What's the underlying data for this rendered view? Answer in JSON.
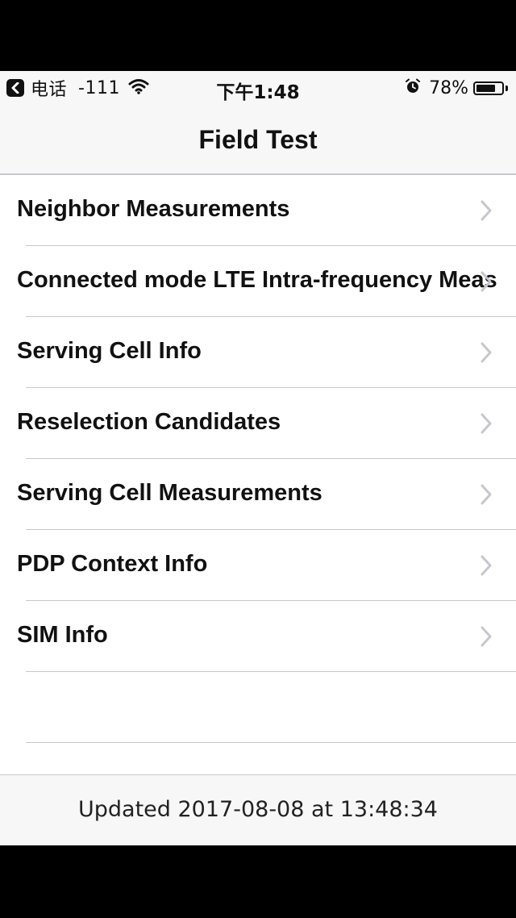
{
  "status_bar": {
    "back_app": "电话",
    "signal": "-111",
    "time": "下午1:48",
    "battery_percent": "78%",
    "battery_level": 0.78
  },
  "nav": {
    "title": "Field Test"
  },
  "menu": {
    "items": [
      {
        "label": "Neighbor Measurements"
      },
      {
        "label": "Connected mode LTE Intra-frequency Meas"
      },
      {
        "label": "Serving Cell Info"
      },
      {
        "label": "Reselection Candidates"
      },
      {
        "label": "Serving Cell Measurements"
      },
      {
        "label": "PDP Context Info"
      },
      {
        "label": "SIM Info"
      },
      {
        "label": ""
      }
    ]
  },
  "footer": {
    "updated_text": "Updated 2017-08-08 at 13:48:34"
  },
  "colors": {
    "bar_background": "#f7f7f7",
    "separator": "#c8c7cc",
    "chevron": "#c7c7cc",
    "text": "#111111"
  }
}
